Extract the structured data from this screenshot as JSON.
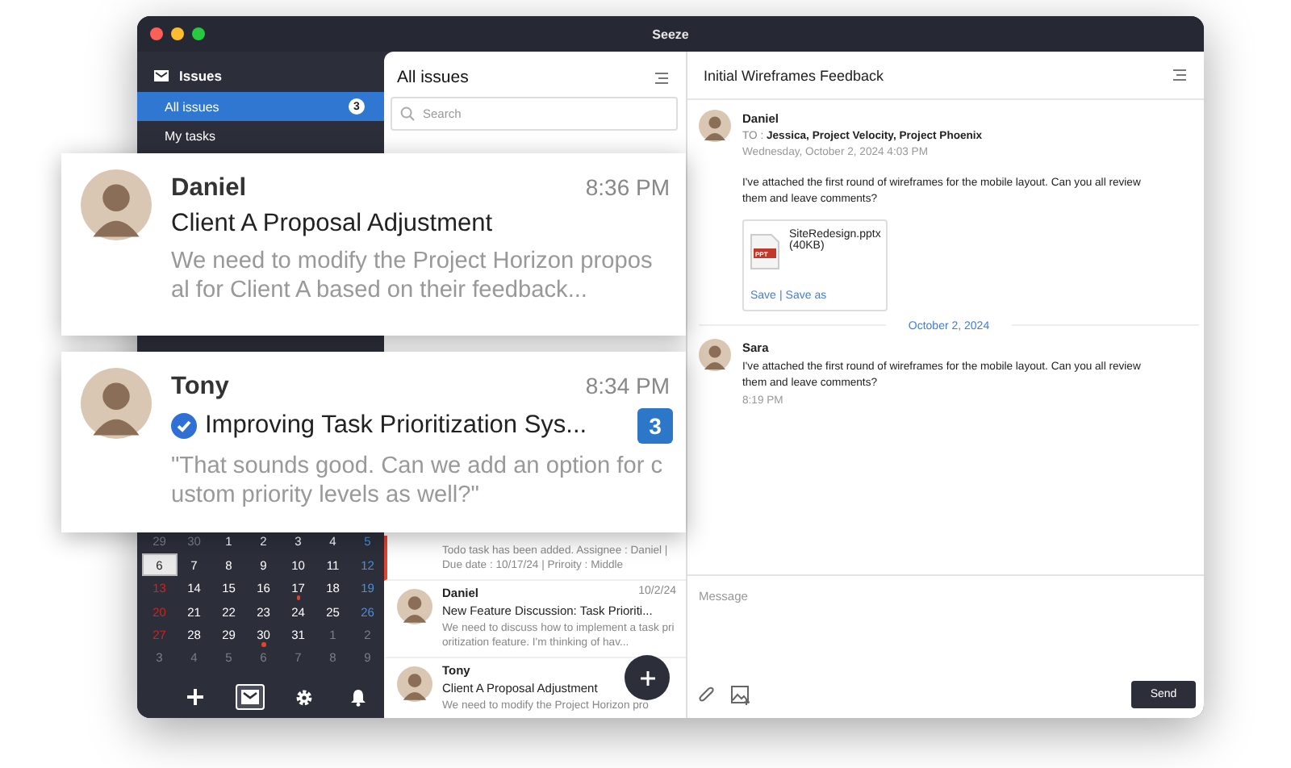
{
  "window": {
    "title": "Seeze"
  },
  "sidebar": {
    "section": "Issues",
    "items": [
      {
        "label": "All issues",
        "badge": "3",
        "selected": true
      },
      {
        "label": "My tasks",
        "selected": false
      }
    ],
    "calendar": {
      "days": [
        {
          "day": "29",
          "kind": "other",
          "selected": false,
          "event": false
        },
        {
          "day": "30",
          "kind": "other",
          "selected": false,
          "event": false
        },
        {
          "day": "1",
          "kind": "weekday",
          "selected": false,
          "event": false
        },
        {
          "day": "2",
          "kind": "weekday",
          "selected": false,
          "event": false
        },
        {
          "day": "3",
          "kind": "weekday",
          "selected": false,
          "event": false
        },
        {
          "day": "4",
          "kind": "weekday",
          "selected": false,
          "event": false
        },
        {
          "day": "5",
          "kind": "saturday",
          "selected": false,
          "event": false
        },
        {
          "day": "6",
          "kind": "sunday",
          "selected": true,
          "event": false
        },
        {
          "day": "7",
          "kind": "weekday",
          "selected": false,
          "event": false
        },
        {
          "day": "8",
          "kind": "weekday",
          "selected": false,
          "event": false
        },
        {
          "day": "9",
          "kind": "weekday",
          "selected": false,
          "event": false
        },
        {
          "day": "10",
          "kind": "weekday",
          "selected": false,
          "event": false
        },
        {
          "day": "11",
          "kind": "weekday",
          "selected": false,
          "event": false
        },
        {
          "day": "12",
          "kind": "saturday",
          "selected": false,
          "event": false
        },
        {
          "day": "13",
          "kind": "sunday",
          "selected": false,
          "event": false
        },
        {
          "day": "14",
          "kind": "weekday",
          "selected": false,
          "event": false
        },
        {
          "day": "15",
          "kind": "weekday",
          "selected": false,
          "event": false
        },
        {
          "day": "16",
          "kind": "weekday",
          "selected": false,
          "event": false
        },
        {
          "day": "17",
          "kind": "weekday",
          "selected": false,
          "event": true
        },
        {
          "day": "18",
          "kind": "weekday",
          "selected": false,
          "event": false
        },
        {
          "day": "19",
          "kind": "saturday",
          "selected": false,
          "event": false
        },
        {
          "day": "20",
          "kind": "sunday",
          "selected": false,
          "event": false
        },
        {
          "day": "21",
          "kind": "weekday",
          "selected": false,
          "event": false
        },
        {
          "day": "22",
          "kind": "weekday",
          "selected": false,
          "event": false
        },
        {
          "day": "23",
          "kind": "weekday",
          "selected": false,
          "event": false
        },
        {
          "day": "24",
          "kind": "weekday",
          "selected": false,
          "event": false
        },
        {
          "day": "25",
          "kind": "weekday",
          "selected": false,
          "event": false
        },
        {
          "day": "26",
          "kind": "saturday",
          "selected": false,
          "event": false
        },
        {
          "day": "27",
          "kind": "sunday",
          "selected": false,
          "event": false
        },
        {
          "day": "28",
          "kind": "weekday",
          "selected": false,
          "event": false
        },
        {
          "day": "29",
          "kind": "weekday",
          "selected": false,
          "event": false
        },
        {
          "day": "30",
          "kind": "weekday",
          "selected": false,
          "event": true
        },
        {
          "day": "31",
          "kind": "weekday",
          "selected": false,
          "event": false
        },
        {
          "day": "1",
          "kind": "other",
          "selected": false,
          "event": false
        },
        {
          "day": "2",
          "kind": "other",
          "selected": false,
          "event": false
        },
        {
          "day": "3",
          "kind": "other",
          "selected": false,
          "event": false
        },
        {
          "day": "4",
          "kind": "other",
          "selected": false,
          "event": false
        },
        {
          "day": "5",
          "kind": "other",
          "selected": false,
          "event": false
        },
        {
          "day": "6",
          "kind": "other",
          "selected": false,
          "event": false
        },
        {
          "day": "7",
          "kind": "other",
          "selected": false,
          "event": false
        },
        {
          "day": "8",
          "kind": "other",
          "selected": false,
          "event": false
        },
        {
          "day": "9",
          "kind": "other",
          "selected": false,
          "event": false
        }
      ]
    },
    "toolbar": [
      {
        "kind": "add",
        "selected": false
      },
      {
        "kind": "mail",
        "selected": true
      },
      {
        "kind": "settings",
        "selected": false
      },
      {
        "kind": "bell",
        "selected": false
      }
    ]
  },
  "issue_list": {
    "title": "All issues",
    "search": {
      "placeholder": "Search"
    },
    "items": [
      {
        "preview": "Todo task has been added. Assignee : Daniel | Due date : 10/17/24 | Priroity : Middle",
        "flagged": true
      },
      {
        "sender": "Daniel",
        "date": "10/2/24",
        "subject": "New Feature Discussion: Task Prioriti...",
        "preview": "We need to discuss how to implement a task prioritization feature. I'm thinking of hav...",
        "flagged": false
      },
      {
        "sender": "Tony",
        "subject": "Client A Proposal Adjustment",
        "preview": "We need to modify the Project Horizon pro",
        "flagged": false
      }
    ]
  },
  "conversation": {
    "title": "Initial Wireframes Feedback",
    "entries": [
      {
        "kind": "message",
        "sender": "Daniel",
        "to_label": "TO :",
        "to": "Jessica, Project Velocity, Project Phoenix",
        "date": "Wednesday, October 2, 2024 4:03 PM",
        "body": "I've attached the first round of wireframes for the mobile layout. Can you all review them and leave comments?",
        "attachment": {
          "name": "SiteRedesign.pptx",
          "size": "(40KB)",
          "type": "PPT",
          "links": [
            "Save",
            "Save as"
          ],
          "separator": "|"
        }
      },
      {
        "kind": "divider",
        "label": "October 2, 2024"
      },
      {
        "kind": "message",
        "sender": "Sara",
        "body": "I've attached the first round of wireframes for the mobile layout. Can you all review them and leave comments?",
        "time": "8:19 PM"
      }
    ],
    "composer": {
      "placeholder": "Message",
      "send": "Send"
    }
  },
  "zoom_cards": [
    {
      "sender": "Daniel",
      "time": "8:36 PM",
      "subject": "Client A Proposal Adjustment",
      "preview": "We need to modify the Project Horizon proposal for Client A based on their feedback...",
      "verified": false
    },
    {
      "sender": "Tony",
      "time": "8:34 PM",
      "subject": "Improving Task Prioritization Sys...",
      "preview": "\"That sounds good. Can we add an option for custom priority levels as well?\"",
      "verified": true,
      "badge": "3"
    }
  ]
}
